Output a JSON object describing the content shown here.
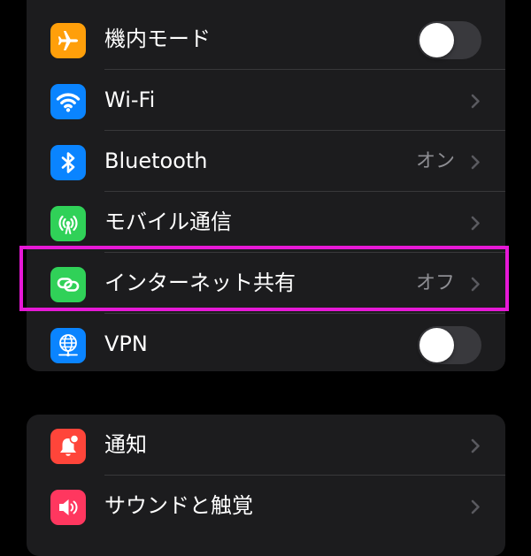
{
  "colors": {
    "background": "#000000",
    "group_background": "#1c1c1e",
    "separator": "#38383a",
    "label": "#ffffff",
    "secondary_label": "#8e8e93",
    "toggle_off": "#39393d",
    "highlight": "#e619d6",
    "airplane_tile": "#ff9f0a",
    "wifi_tile": "#0a84ff",
    "bluetooth_tile": "#0a84ff",
    "cellular_tile": "#30d158",
    "hotspot_tile": "#30d158",
    "vpn_tile": "#0a84ff",
    "notifications_tile": "#ff453a",
    "sounds_tile": "#ff375f"
  },
  "settings": {
    "airplane": {
      "label": "機内モード",
      "icon": "airplane-icon",
      "toggle_on": false
    },
    "wifi": {
      "label": "Wi-Fi",
      "icon": "wifi-icon"
    },
    "bluetooth": {
      "label": "Bluetooth",
      "value": "オン",
      "icon": "bluetooth-icon"
    },
    "cellular": {
      "label": "モバイル通信",
      "icon": "antenna-icon"
    },
    "hotspot": {
      "label": "インターネット共有",
      "value": "オフ",
      "icon": "link-icon",
      "highlighted": true
    },
    "vpn": {
      "label": "VPN",
      "icon": "globe-network-icon",
      "toggle_on": false
    },
    "notifications": {
      "label": "通知",
      "icon": "bell-badge-icon"
    },
    "sounds": {
      "label": "サウンドと触覚",
      "icon": "speaker-icon"
    }
  }
}
